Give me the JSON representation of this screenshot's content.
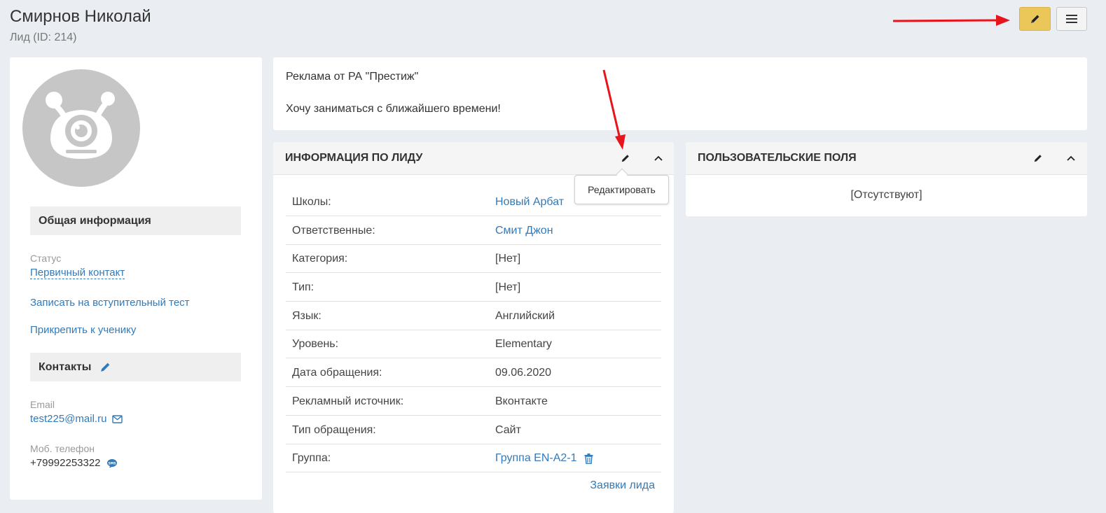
{
  "header": {
    "title": "Смирнов Николай",
    "subtitle": "Лид (ID: 214)"
  },
  "note": {
    "line1": "Реклама от РА \"Престиж\"",
    "line2": "Хочу заниматься с ближайшего времени!"
  },
  "left": {
    "general_title": "Общая информация",
    "status_label": "Статус",
    "status_value": "Первичный контакт",
    "link_test": "Записать на вступительный тест",
    "link_attach": "Прикрепить к ученику",
    "contacts_title": "Контакты",
    "email_label": "Email",
    "email_value": "test225@mail.ru",
    "phone_label": "Моб. телефон",
    "phone_value": "+79992253322"
  },
  "lead_info": {
    "title": "ИНФОРМАЦИЯ ПО ЛИДУ",
    "rows": [
      {
        "label": "Школы:",
        "value": "Новый Арбат"
      },
      {
        "label": "Ответственные:",
        "value": "Смит Джон"
      },
      {
        "label": "Категория:",
        "value": "[Нет]"
      },
      {
        "label": "Тип:",
        "value": "[Нет]"
      },
      {
        "label": "Язык:",
        "value": "Английский"
      },
      {
        "label": "Уровень:",
        "value": "Elementary"
      },
      {
        "label": "Дата обращения:",
        "value": "09.06.2020"
      },
      {
        "label": "Рекламный источник:",
        "value": "Вконтакте"
      },
      {
        "label": "Тип обращения:",
        "value": "Сайт"
      },
      {
        "label": "Группа:",
        "value": "Группа EN-A2-1"
      }
    ],
    "footer_link": "Заявки лида",
    "tooltip": "Редактировать"
  },
  "custom_fields": {
    "title": "ПОЛЬЗОВАТЕЛЬСКИЕ ПОЛЯ",
    "empty_text": "[Отсутствуют]"
  },
  "colors": {
    "accent_link": "#337ab7",
    "edit_button": "#ebc75a",
    "annotation_arrow": "#e8141b"
  }
}
